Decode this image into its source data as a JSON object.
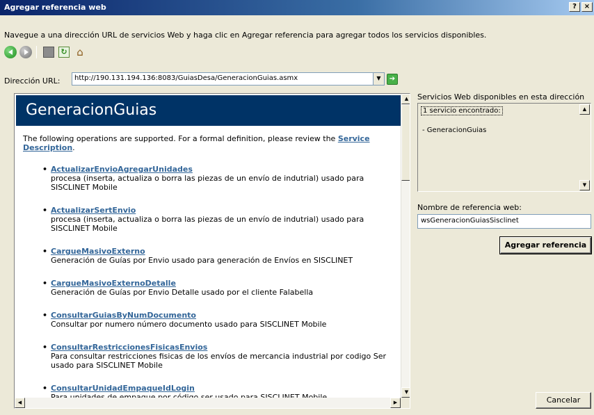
{
  "window": {
    "title": "Agregar referencia web",
    "help_label": "?",
    "close_label": "×"
  },
  "instruction": "Navegue a una dirección URL de servicios Web y haga clic en Agregar referencia para agregar todos los servicios disponibles.",
  "toolbar": {
    "icons": [
      "back-icon",
      "forward-icon",
      "stop-icon",
      "refresh-icon",
      "home-icon"
    ]
  },
  "url": {
    "label": "Dirección URL:",
    "value": "http://190.131.194.136:8083/GuiasDesa/GeneracionGuias.asmx"
  },
  "browser": {
    "heading": "GeneracionGuias",
    "intro_text": "The following operations are supported. For a formal definition, please review the ",
    "intro_link": "Service Description",
    "intro_end": ".",
    "operations": [
      {
        "name": "ActualizarEnvioAgregarUnidades",
        "desc": "procesa (inserta, actualiza o borra las piezas de un envío de indutrial) usado para SISCLINET Mobile"
      },
      {
        "name": "ActualizarSertEnvio",
        "desc": "procesa (inserta, actualiza o borra las piezas de un envío de indutrial) usado para SISCLINET Mobile"
      },
      {
        "name": "CargueMasivoExterno",
        "desc": "Generación de Guías por Envio usado para generación de Envíos en SISCLINET"
      },
      {
        "name": "CargueMasivoExternoDetalle",
        "desc": "Generación de Guías por Envio Detalle usado por el cliente Falabella"
      },
      {
        "name": "ConsultarGuiasByNumDocumento",
        "desc": "Consultar por numero número documento usado para SISCLINET Mobile"
      },
      {
        "name": "ConsultarRestriccionesFisicasEnvios",
        "desc": "Para consultar restricciones fisicas de los envíos de mercancia industrial por codigo Ser usado para SISCLINET Mobile"
      },
      {
        "name": "ConsultarUnidadEmpaqueIdLogin",
        "desc": "Para unidades de empaque por código ser usado para SISCLINET Mobile"
      }
    ]
  },
  "services": {
    "label": "Servicios Web disponibles en esta dirección URL:",
    "found": "1 servicio encontrado:",
    "item": "- GeneracionGuias"
  },
  "reference": {
    "label": "Nombre de referencia web:",
    "value": "wsGeneracionGuiasSisclinet"
  },
  "buttons": {
    "add": "Agregar referencia",
    "cancel": "Cancelar"
  }
}
